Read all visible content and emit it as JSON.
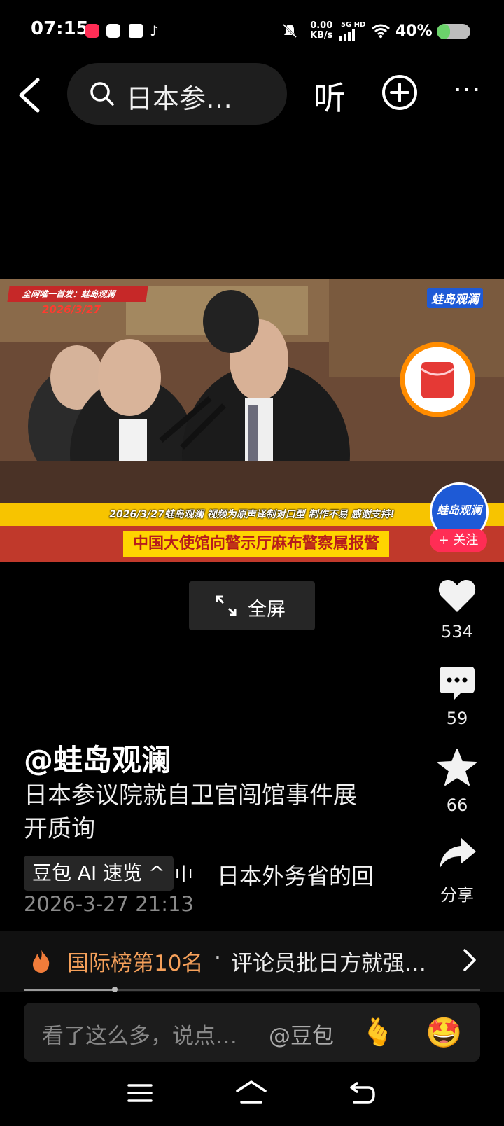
{
  "status_bar": {
    "time": "07:15",
    "network_speed_value": "0.00",
    "network_speed_unit": "KB/s",
    "network_type": "5G HD",
    "battery_text": "40%",
    "battery_level": 0.4
  },
  "top_bar": {
    "search_text": "日本参…",
    "listen_label": "听",
    "more_label": "⋯"
  },
  "video": {
    "overlay_top_text": "全网唯一首发：蛙岛观澜",
    "overlay_date": "2026/3/27",
    "overlay_logo": "蛙岛观澜",
    "overlay_ticker": "2026/3/27蛙岛观澜  视频为原声译制对口型  制作不易  感谢支持!",
    "overlay_title": "中国大使馆向警示厅麻布警察属报警",
    "channel_avatar_text": "蛙岛观澜",
    "follow_label": "+ 关注"
  },
  "fullscreen_label": "全屏",
  "actions": {
    "like_count": "534",
    "comment_count": "59",
    "favorite_count": "66",
    "share_label": "分享"
  },
  "post": {
    "author": "@蛙岛观澜",
    "description": "日本参议院就自卫官闯馆事件展开质询",
    "ai_chip_label": "豆包 AI 速览 ^",
    "ai_summary_preview": "日本外务省的回",
    "timestamp": "2026-3-27 21:13"
  },
  "ranking": {
    "label": "国际榜第10名",
    "separator": "·",
    "headline": "评论员批日方就强…"
  },
  "playback_progress": 0.2,
  "comment_bar": {
    "placeholder": "看了这么多，说点…",
    "mention": "@豆包",
    "emoji_1": "🫰",
    "emoji_2": "🤩"
  },
  "colors": {
    "background": "#000000",
    "accent_orange": "#f5a05a",
    "follow_red": "#ff2d55"
  }
}
